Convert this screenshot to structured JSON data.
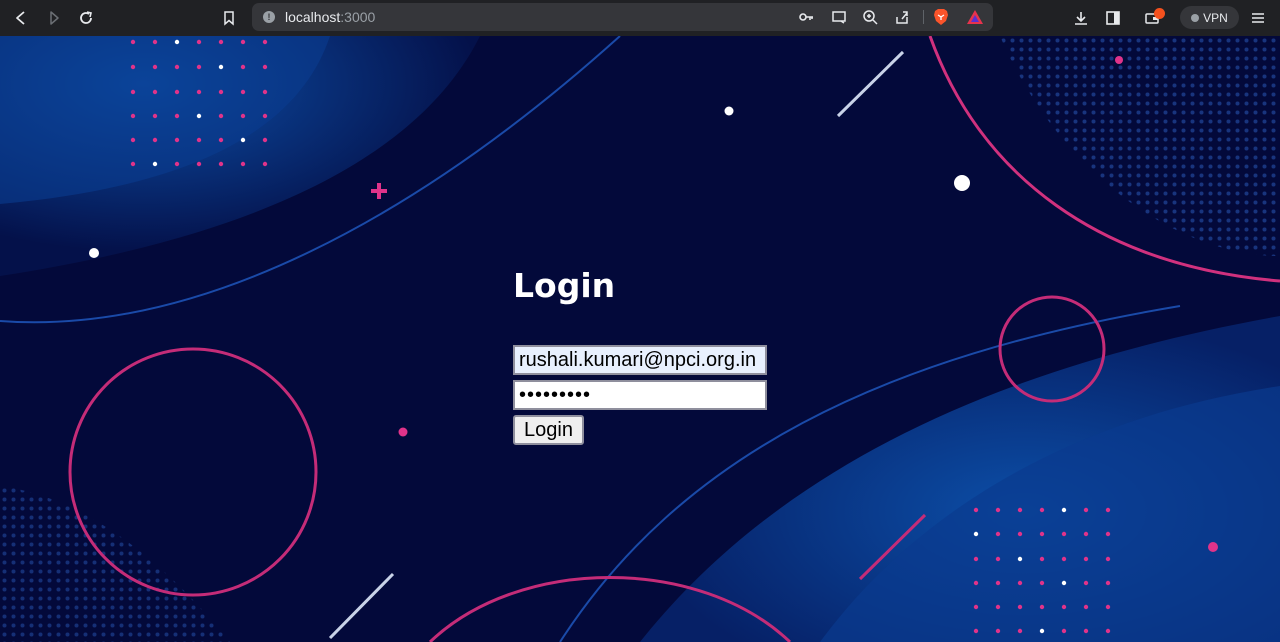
{
  "browser": {
    "url_host": "localhost",
    "url_port": ":3000",
    "vpn_label": "VPN",
    "icons": {
      "back": "back-icon",
      "forward": "forward-icon",
      "reload": "reload-icon",
      "bookmark": "bookmark-icon",
      "site_info": "info-icon",
      "password_key": "key-icon",
      "cast": "cast-icon",
      "zoom": "zoom-icon",
      "share": "share-icon",
      "brave_shields": "brave-lion-icon",
      "brave_rewards": "rewards-triangle-icon",
      "download": "download-icon",
      "sidebar": "sidebar-icon",
      "wallet": "wallet-icon",
      "menu": "menu-icon"
    }
  },
  "login": {
    "title": "Login",
    "email_value": "rushali.kumari@npci.org.in",
    "password_value": "password1",
    "button_label": "Login"
  },
  "colors": {
    "background": "#03093a",
    "accent_pink": "#d63384",
    "accent_blue": "#0b3a8c"
  }
}
